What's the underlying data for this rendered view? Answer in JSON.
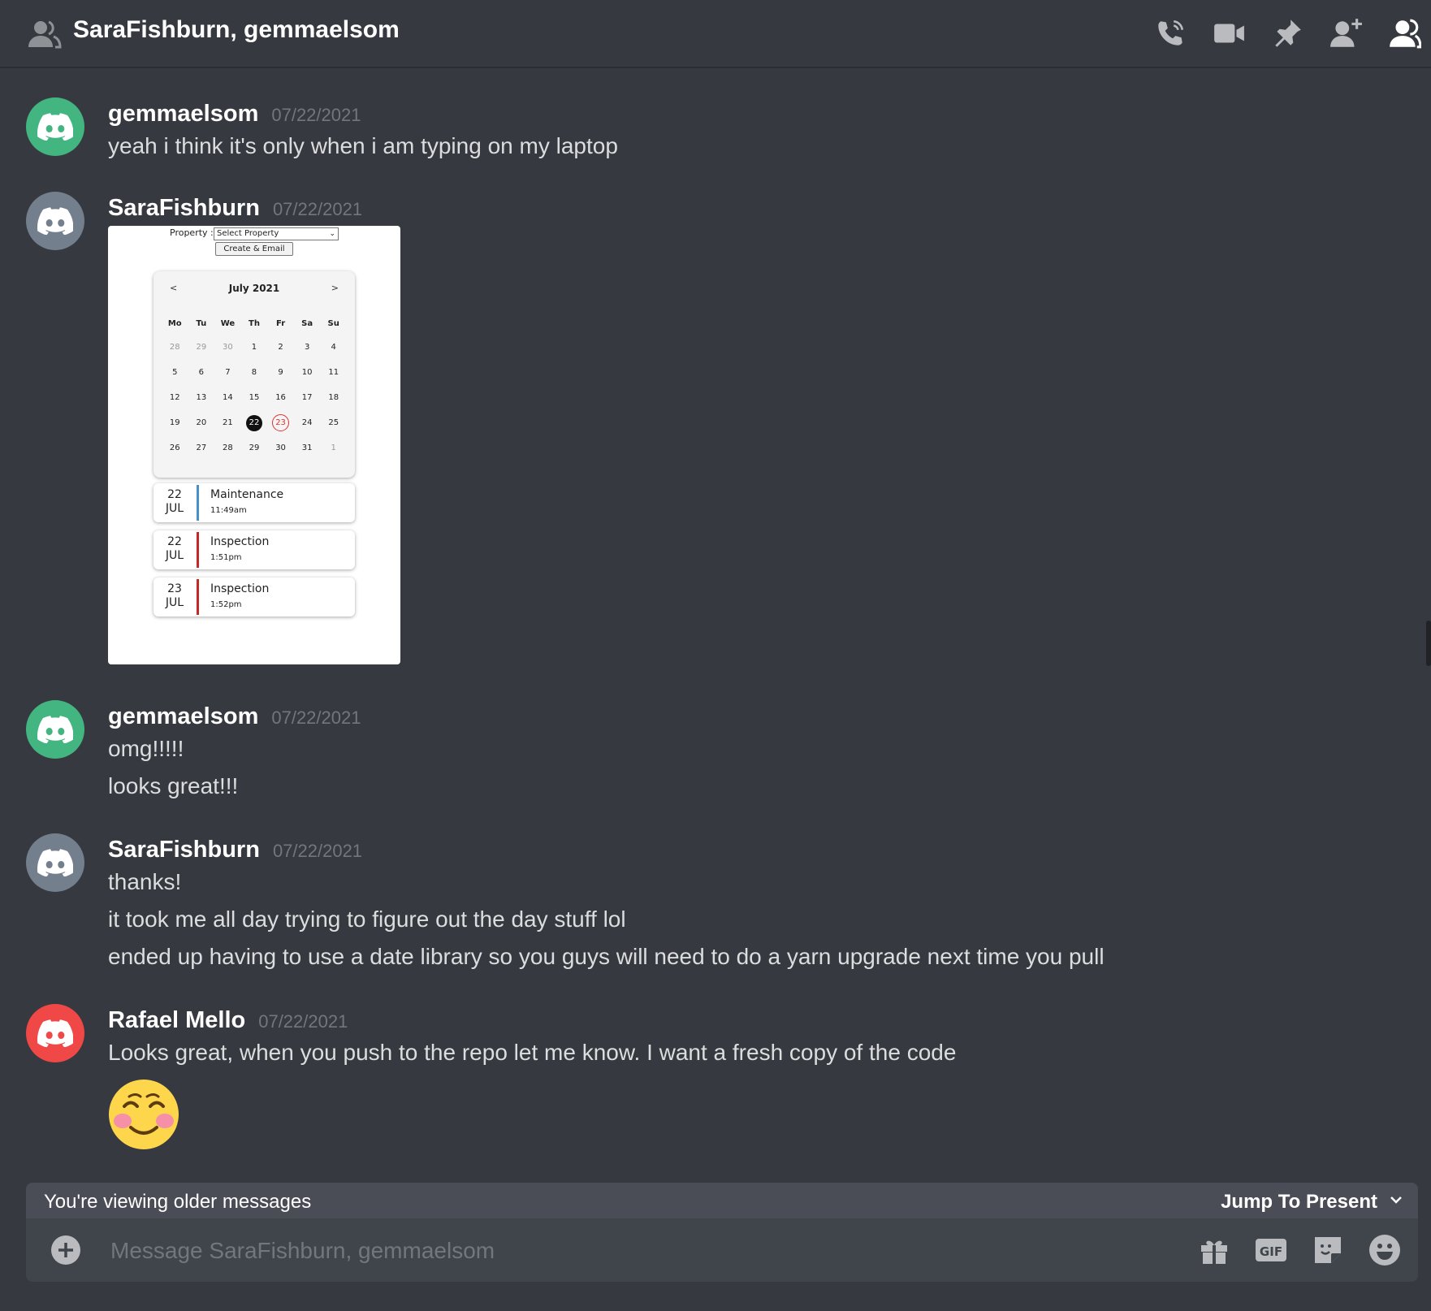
{
  "header": {
    "title": "SaraFishburn, gemmaelsom",
    "icons": [
      "call-icon",
      "video-icon",
      "pin-icon",
      "add-friend-icon",
      "members-icon"
    ]
  },
  "messages": [
    {
      "author": "gemmaelsom",
      "timestamp": "07/22/2021",
      "avatar_color": "#43b581",
      "lines": [
        "yeah i think it's only when i am typing on my laptop"
      ]
    },
    {
      "author": "SaraFishburn",
      "timestamp": "07/22/2021",
      "avatar_color": "#747f8d",
      "attachment": {
        "property_label": "Property :",
        "select_value": "Select Property",
        "button_label": "Create & Email",
        "calendar": {
          "title": "July 2021",
          "prev": "<",
          "next": ">",
          "weekdays": [
            "Mo",
            "Tu",
            "We",
            "Th",
            "Fr",
            "Sa",
            "Su"
          ],
          "days": [
            "28",
            "29",
            "30",
            "1",
            "2",
            "3",
            "4",
            "5",
            "6",
            "7",
            "8",
            "9",
            "10",
            "11",
            "12",
            "13",
            "14",
            "15",
            "16",
            "17",
            "18",
            "19",
            "20",
            "21",
            "22",
            "23",
            "24",
            "25",
            "26",
            "27",
            "28",
            "29",
            "30",
            "31",
            "1"
          ],
          "selected": "22",
          "today": "23"
        },
        "events": [
          {
            "day": "22",
            "month": "JUL",
            "title": "Maintenance",
            "time": "11:49am",
            "color": "#4a90c8"
          },
          {
            "day": "22",
            "month": "JUL",
            "title": "Inspection",
            "time": "1:51pm",
            "color": "#c62828"
          },
          {
            "day": "23",
            "month": "JUL",
            "title": "Inspection",
            "time": "1:52pm",
            "color": "#c62828"
          }
        ]
      }
    },
    {
      "author": "gemmaelsom",
      "timestamp": "07/22/2021",
      "avatar_color": "#43b581",
      "lines": [
        "omg!!!!!",
        "looks great!!!"
      ]
    },
    {
      "author": "SaraFishburn",
      "timestamp": "07/22/2021",
      "avatar_color": "#747f8d",
      "lines": [
        "thanks!",
        "it took me all day trying to figure out the day stuff lol",
        "ended up having to use a date library so you guys will need to do a yarn upgrade next time you pull"
      ]
    },
    {
      "author": "Rafael Mello",
      "timestamp": "07/22/2021",
      "avatar_color": "#f04747",
      "lines": [
        "Looks great, when you push to the repo let me know. I want a fresh copy of the code"
      ],
      "emoji": "smiling-face-with-blush"
    }
  ],
  "older_bar": {
    "text": "You're viewing older messages",
    "jump": "Jump To Present"
  },
  "composer": {
    "placeholder": "Message SaraFishburn, gemmaelsom",
    "icons": [
      "gift-icon",
      "gif-icon",
      "sticker-icon",
      "emoji-icon"
    ],
    "gif_label": "GIF"
  }
}
